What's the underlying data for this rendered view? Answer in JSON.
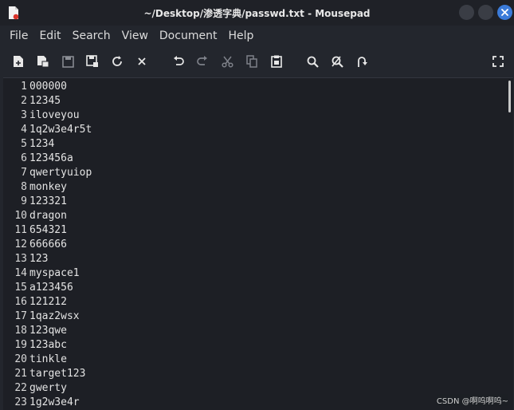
{
  "window": {
    "title": "~/Desktop/渗透字典/passwd.txt - Mousepad",
    "accent_color": "#3b7bd9"
  },
  "menu": {
    "items": [
      "File",
      "Edit",
      "Search",
      "View",
      "Document",
      "Help"
    ]
  },
  "toolbar": {
    "buttons": [
      "new-document-icon",
      "new-window-icon",
      "save-icon",
      "save-as-icon",
      "reload-icon",
      "close-document-icon",
      "undo-icon",
      "redo-icon",
      "cut-icon",
      "copy-icon",
      "paste-icon",
      "find-icon",
      "find-replace-icon",
      "go-to-line-icon",
      "fullscreen-icon"
    ]
  },
  "editor": {
    "lines": [
      "000000",
      "12345",
      "iloveyou",
      "1q2w3e4r5t",
      "1234",
      "123456a",
      "qwertyuiop",
      "monkey",
      "123321",
      "dragon",
      "654321",
      "666666",
      "123",
      "myspace1",
      "a123456",
      "121212",
      "1qaz2wsx",
      "123qwe",
      "123abc",
      "tinkle",
      "target123",
      "gwerty",
      "1g2w3e4r"
    ],
    "line_numbers": [
      "1",
      "2",
      "3",
      "4",
      "5",
      "6",
      "7",
      "8",
      "9",
      "10",
      "11",
      "12",
      "13",
      "14",
      "15",
      "16",
      "17",
      "18",
      "19",
      "20",
      "21",
      "22",
      "23"
    ]
  },
  "watermark": {
    "text": "CSDN @啊呜啊呜~"
  }
}
